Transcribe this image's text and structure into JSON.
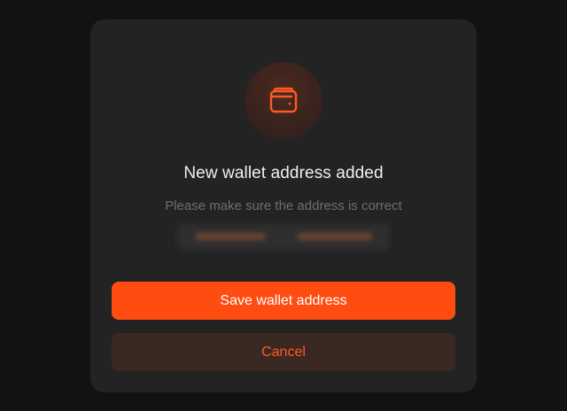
{
  "modal": {
    "title": "New wallet address added",
    "subtitle": "Please make sure the address is correct",
    "icon": "wallet-icon",
    "address": {
      "blurred": true
    },
    "save_label": "Save wallet address",
    "cancel_label": "Cancel"
  },
  "colors": {
    "accent": "#ff4d12",
    "background": "#121212",
    "modal_bg": "#232323",
    "cancel_bg": "#3a2823"
  }
}
